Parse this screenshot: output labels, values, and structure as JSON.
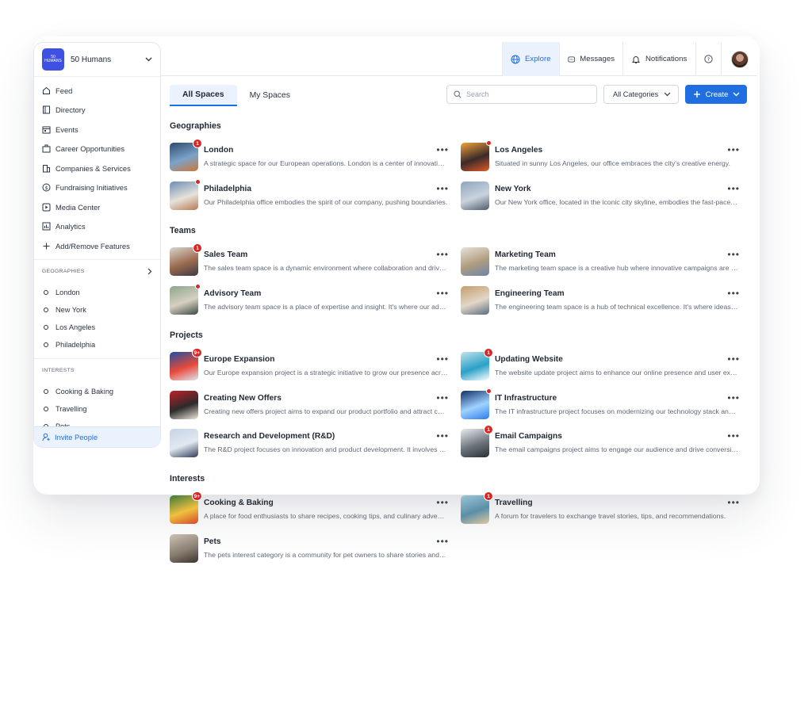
{
  "workspace": {
    "logo_line1": "50",
    "logo_line2": "HUMANS",
    "name": "50 Humans"
  },
  "sidebar": {
    "nav": [
      {
        "label": "Feed",
        "icon": "home-icon"
      },
      {
        "label": "Directory",
        "icon": "book-icon"
      },
      {
        "label": "Events",
        "icon": "calendar-icon"
      },
      {
        "label": "Career Opportunities",
        "icon": "briefcase-icon"
      },
      {
        "label": "Companies & Services",
        "icon": "building-icon"
      },
      {
        "label": "Fundraising Initiatives",
        "icon": "dollar-icon"
      },
      {
        "label": "Media Center",
        "icon": "play-icon"
      },
      {
        "label": "Analytics",
        "icon": "chart-icon"
      },
      {
        "label": "Add/Remove Features",
        "icon": "plus-icon"
      }
    ],
    "geographies": {
      "title": "GEOGRAPHIES",
      "items": [
        "London",
        "New York",
        "Los Angeles",
        "Philadelphia"
      ]
    },
    "interests": {
      "title": "INTERESTS",
      "items": [
        "Cooking & Baking",
        "Travelling",
        "Pets"
      ]
    },
    "invite": "Invite People"
  },
  "topbar": {
    "explore": "Explore",
    "messages": "Messages",
    "notifications": "Notifications"
  },
  "tabs": {
    "all": "All Spaces",
    "my": "My Spaces"
  },
  "search": {
    "placeholder": "Search"
  },
  "categories": {
    "selected": "All Categories"
  },
  "create": {
    "label": "Create"
  },
  "sections": [
    {
      "title": "Geographies",
      "cards": [
        {
          "title": "London",
          "desc": "A strategic space for our European operations. London is a center of innovation and growth.",
          "badge": "1"
        },
        {
          "title": "Los Angeles",
          "desc": "Situated in sunny Los Angeles, our office embraces the city's creative energy.",
          "badge": "dot"
        },
        {
          "title": "Philadelphia",
          "desc": "Our Philadelphia office embodies the spirit of our company, pushing boundaries.",
          "badge": "dot"
        },
        {
          "title": "New York",
          "desc": "Our New York office, located in the iconic city skyline, embodies the fast-paced spirit.",
          "badge": ""
        }
      ]
    },
    {
      "title": "Teams",
      "cards": [
        {
          "title": "Sales Team",
          "desc": "The sales team space is a dynamic environment where collaboration and drive thrive.",
          "badge": "1"
        },
        {
          "title": "Marketing Team",
          "desc": "The marketing team space is a creative hub where innovative campaigns are born.",
          "badge": ""
        },
        {
          "title": "Advisory Team",
          "desc": "The advisory team space is a place of expertise and insight. It's where our advisors meet.",
          "badge": "dot"
        },
        {
          "title": "Engineering Team",
          "desc": "The engineering team space is a hub of technical excellence. It's where ideas are built.",
          "badge": ""
        }
      ]
    },
    {
      "title": "Projects",
      "cards": [
        {
          "title": "Europe Expansion",
          "desc": "Our Europe expansion project is a strategic initiative to grow our presence across Europe.",
          "badge": "9+"
        },
        {
          "title": "Updating Website",
          "desc": "The website update project aims to enhance our online presence and user experience.",
          "badge": "1"
        },
        {
          "title": "Creating New Offers",
          "desc": "Creating new offers project aims to expand our product portfolio and attract customers.",
          "badge": ""
        },
        {
          "title": "IT Infrastructure",
          "desc": "The IT infrastructure project focuses on modernizing our technology stack and systems.",
          "badge": "dot"
        },
        {
          "title": "Research and Development (R&D)",
          "desc": "The R&D project focuses on innovation and product development. It involves research.",
          "badge": ""
        },
        {
          "title": "Email Campaigns",
          "desc": "The email campaigns project aims to engage our audience and drive conversions.",
          "badge": "1"
        }
      ]
    },
    {
      "title": "Interests",
      "cards": [
        {
          "title": "Cooking & Baking",
          "desc": "A place for food enthusiasts to share recipes, cooking tips, and culinary adventures.",
          "badge": "9+"
        },
        {
          "title": "Travelling",
          "desc": "A forum for travelers to exchange travel stories, tips, and recommendations.",
          "badge": "1"
        },
        {
          "title": "Pets",
          "desc": "The pets interest category is a community for pet owners to share stories and photos.",
          "badge": ""
        }
      ]
    }
  ]
}
